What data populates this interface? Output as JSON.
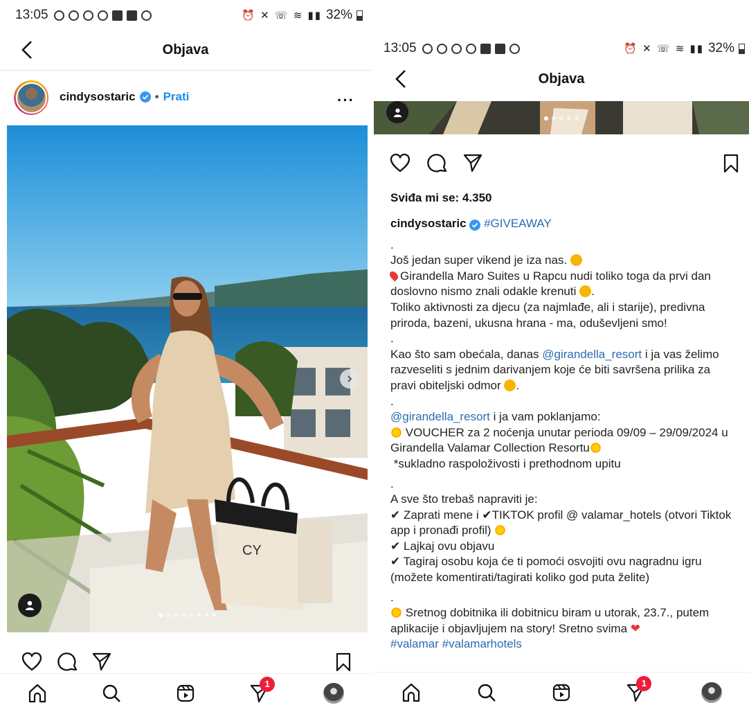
{
  "left": {
    "status": {
      "time": "13:05",
      "battery": "32%"
    },
    "header": {
      "title": "Objava"
    },
    "post": {
      "username": "cindysostaric",
      "separator": "•",
      "follow_label": "Prati",
      "more_label": "···"
    },
    "nav_badge": "1"
  },
  "right": {
    "status": {
      "time": "13:05",
      "battery": "32%"
    },
    "header": {
      "title": "Objava"
    },
    "likes": "Sviđa mi se: 4.350",
    "caption": {
      "username": "cindysostaric",
      "hashtag": "#GIVEAWAY",
      "dot": ".",
      "l1": "Još jedan super vikend je iza nas.",
      "l2": "Girandella Maro Suites u Rapcu nudi toliko toga da prvi dan doslovno nismo znali odakle krenuti",
      "l2_end": ".",
      "l3": "Toliko aktivnosti za djecu (za najmlađe, ali i starije), predivna priroda, bazeni, ukusna hrana - ma, oduševljeni smo!",
      "l4_a": "Kao što sam obećala, danas ",
      "mention": "@girandella_resort",
      "l4_b": " i ja vas želimo razveseliti s jednim darivanjem koje će biti savršena prilika za pravi obiteljski odmor",
      "l5_b": " i ja vam poklanjamo:",
      "l6": "VOUCHER za 2 noćenja unutar perioda 09/09 – 29/09/2024 u Girandella Valamar Collection Resortu",
      "l7": "*sukladno raspoloživosti i prethodnom upitu",
      "l8": "A sve što trebaš napraviti je:",
      "check": "✔",
      "l9_a": "Zaprati mene i ",
      "l9_b": "TIKTOK profil @ valamar_hotels (otvori Tiktok app i pronađi profil)",
      "l10": "Lajkaj ovu objavu",
      "l11": "Tagiraj osobu koja će ti pomoći osvojiti ovu nagradnu igru (možete komentirati/tagirati koliko god puta želite)",
      "l12": "Sretnog dobitnika ili dobitnicu biram u utorak, 23.7., putem aplikacije i objavljujem na story! Sretno svima",
      "heart": "❤",
      "tags": "#valamar #valamarhotels"
    },
    "nav_badge": "1"
  },
  "colors": {
    "link": "#2b6cb0",
    "follow": "#1a8cf0",
    "badge": "#ef1d3a",
    "verified": "#3897f0"
  }
}
